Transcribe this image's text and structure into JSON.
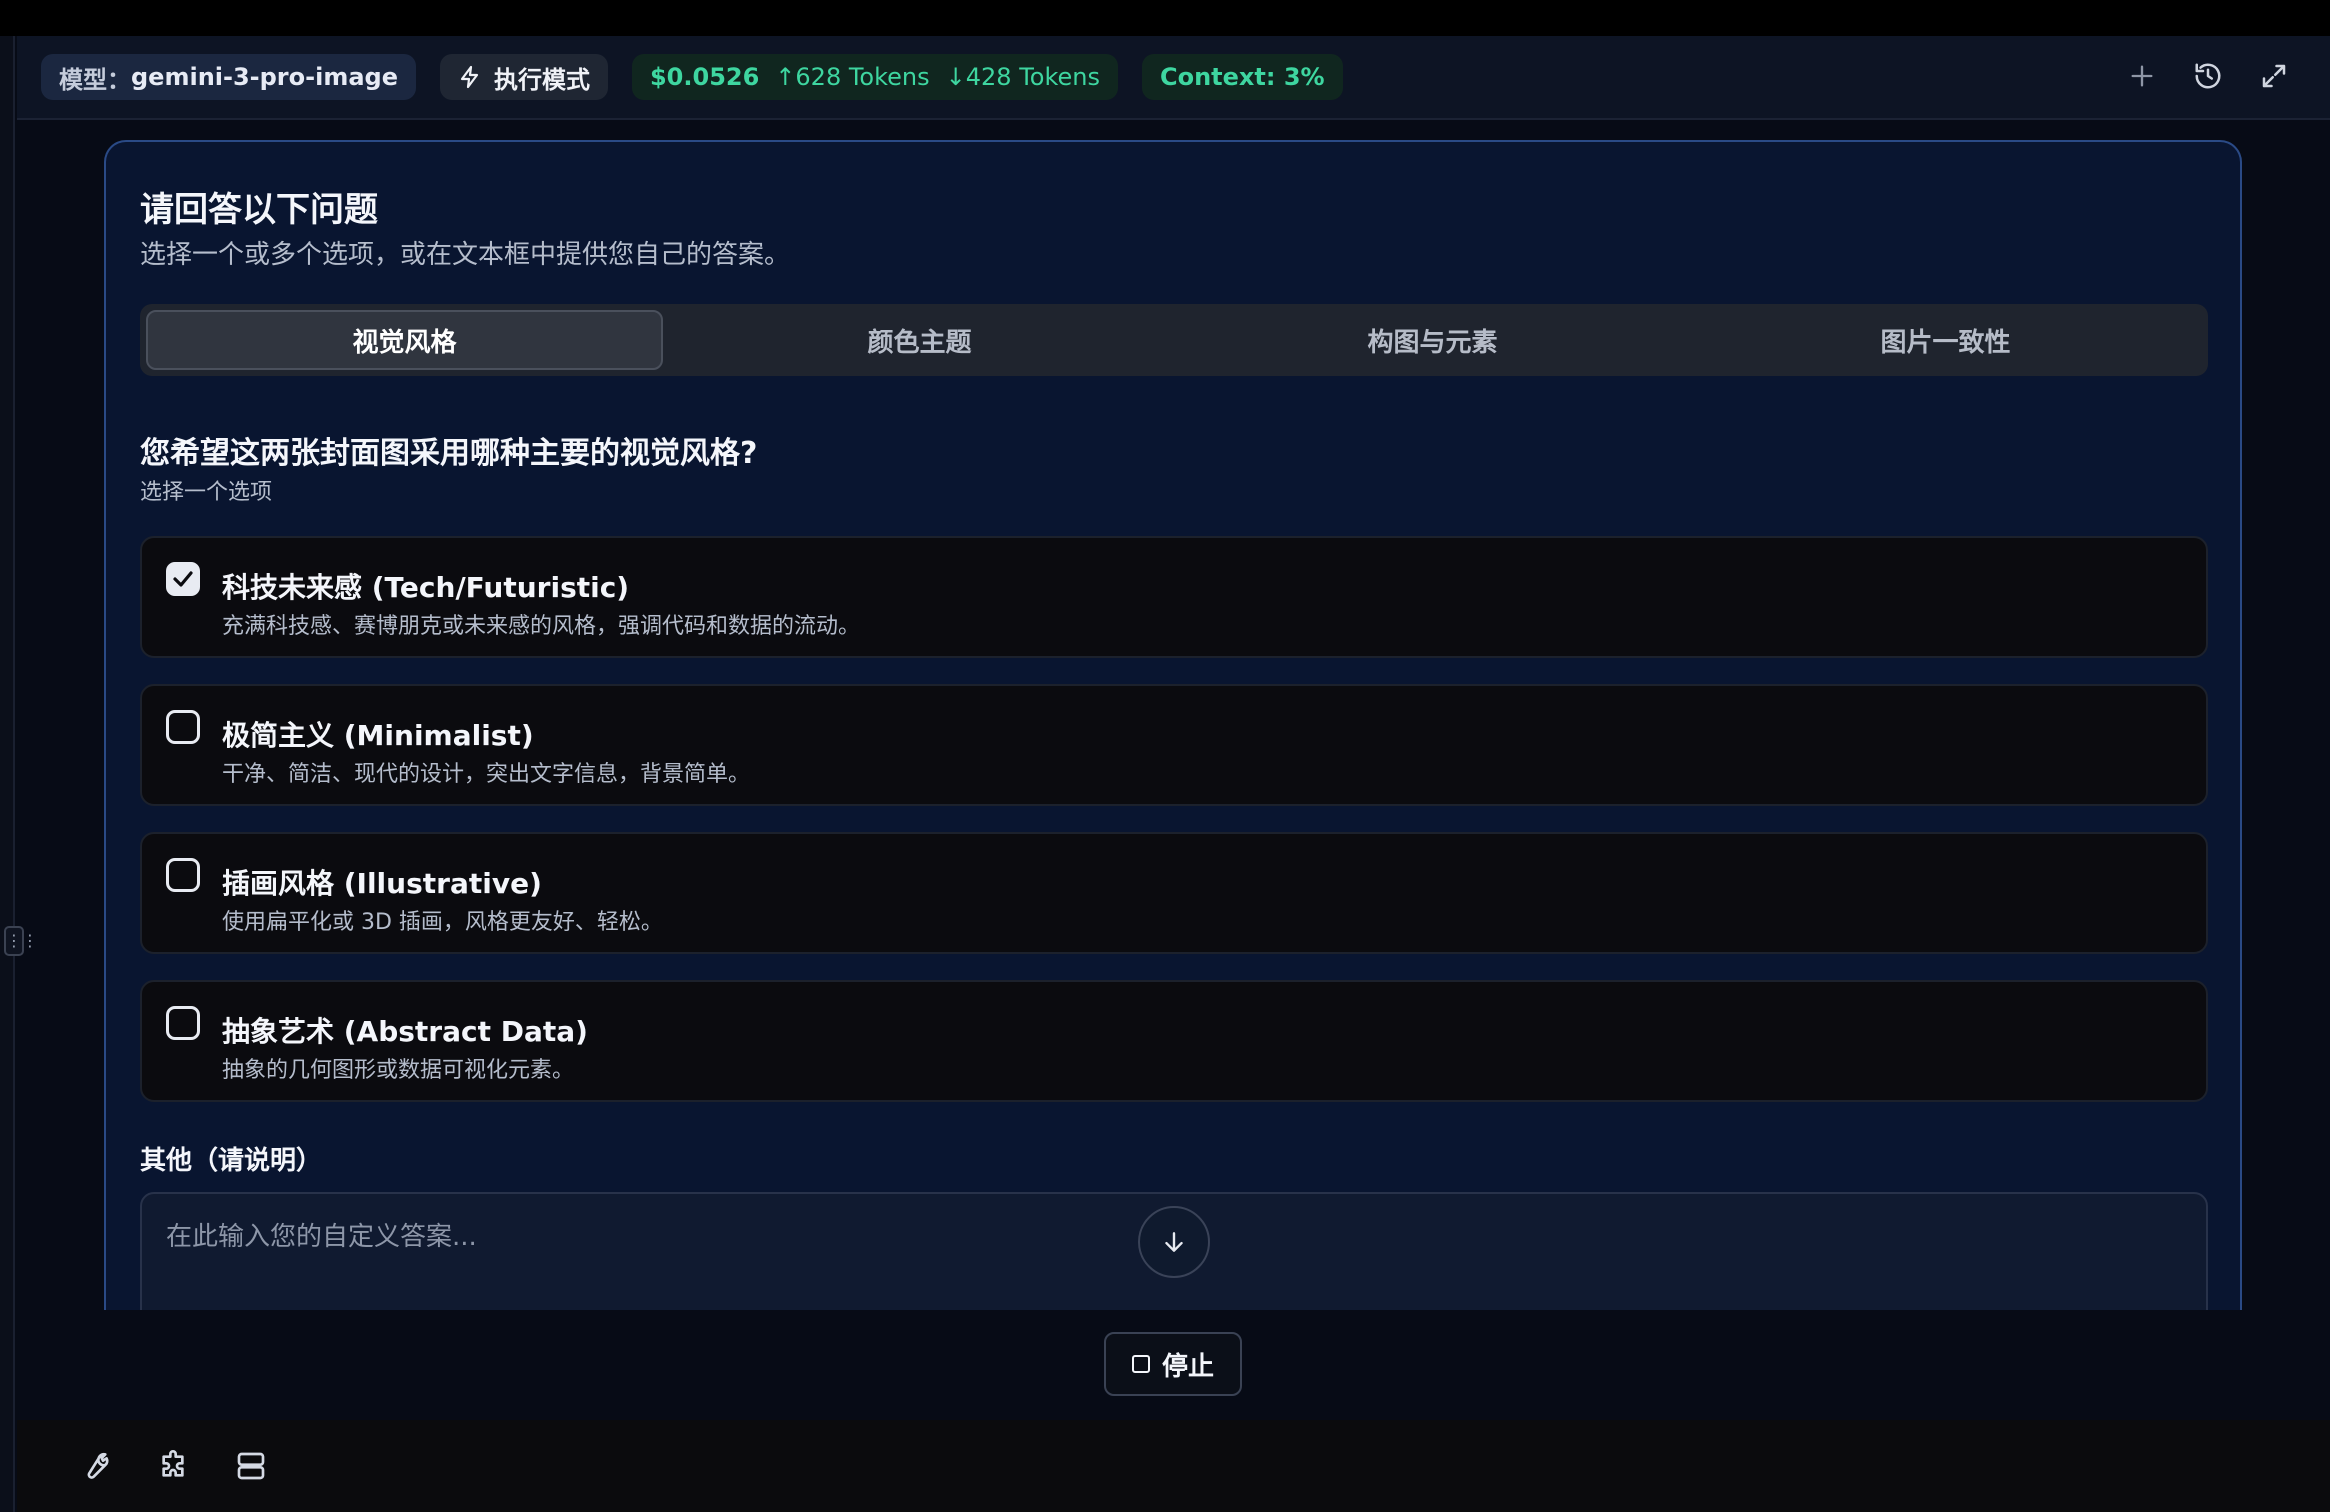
{
  "header": {
    "model_label": "模型：",
    "model_value": "gemini-3-pro-image",
    "mode_label": "执行模式",
    "cost_amount": "$0.0526",
    "tokens_up": "↑628 Tokens",
    "tokens_down": "↓428 Tokens",
    "context": "Context: 3%",
    "actions": [
      "plus-icon",
      "history-icon",
      "expand-icon"
    ]
  },
  "card": {
    "title": "请回答以下问题",
    "subtitle": "选择一个或多个选项，或在文本框中提供您自己的答案。",
    "tabs": [
      {
        "label": "视觉风格",
        "active": true
      },
      {
        "label": "颜色主题",
        "active": false
      },
      {
        "label": "构图与元素",
        "active": false
      },
      {
        "label": "图片一致性",
        "active": false
      }
    ],
    "question": {
      "title": "您希望这两张封面图采用哪种主要的视觉风格?",
      "hint": "选择一个选项",
      "options": [
        {
          "label": "科技未来感 (Tech/Futuristic)",
          "desc": "充满科技感、赛博朋克或未来感的风格，强调代码和数据的流动。",
          "checked": true
        },
        {
          "label": "极简主义 (Minimalist)",
          "desc": "干净、简洁、现代的设计，突出文字信息，背景简单。",
          "checked": false
        },
        {
          "label": "插画风格 (Illustrative)",
          "desc": "使用扁平化或 3D 插画，风格更友好、轻松。",
          "checked": false
        },
        {
          "label": "抽象艺术 (Abstract Data)",
          "desc": "抽象的几何图形或数据可视化元素。",
          "checked": false
        }
      ]
    },
    "other": {
      "label": "其他（请说明）",
      "placeholder": "在此输入您的自定义答案...",
      "value": ""
    }
  },
  "stop_button": {
    "label": "停止"
  },
  "footer": {
    "tools": [
      "wrench-icon",
      "puzzle-icon",
      "server-icon"
    ]
  },
  "colors": {
    "accent_green": "#3ed6a0",
    "card_border": "#2a4a86",
    "background": "#070b16"
  }
}
